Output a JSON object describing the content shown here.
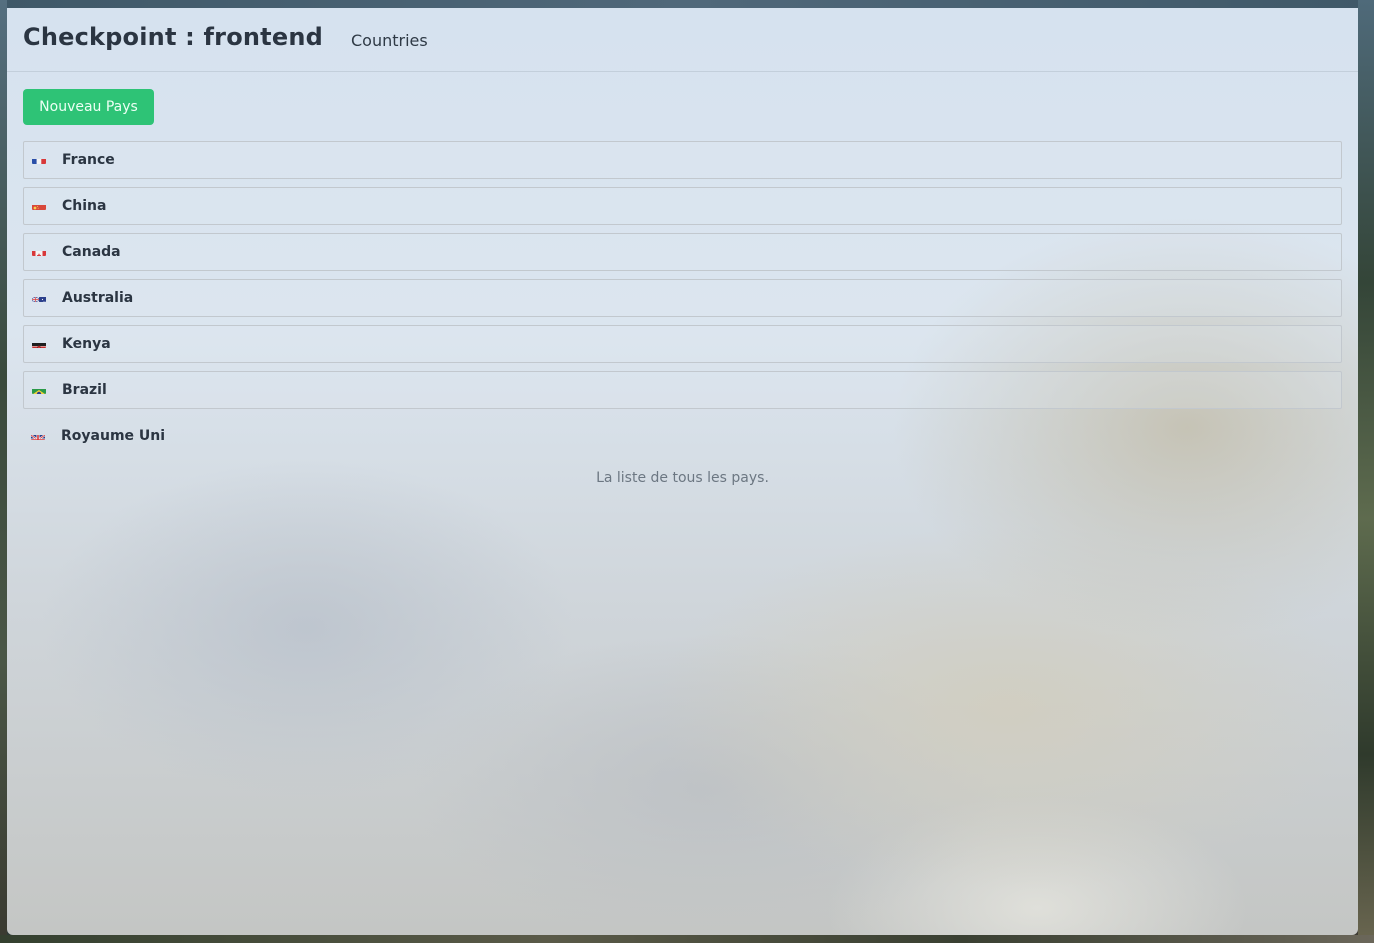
{
  "app": {
    "title": "Checkpoint : frontend",
    "nav_link": "Countries"
  },
  "toolbar": {
    "new_button_label": "Nouveau Pays"
  },
  "countries": [
    {
      "name": "France",
      "flag_icon": "flag-france-icon"
    },
    {
      "name": "China",
      "flag_icon": "flag-china-icon"
    },
    {
      "name": "Canada",
      "flag_icon": "flag-canada-icon"
    },
    {
      "name": "Australia",
      "flag_icon": "flag-australia-icon"
    },
    {
      "name": "Kenya",
      "flag_icon": "flag-kenya-icon"
    },
    {
      "name": "Brazil",
      "flag_icon": "flag-brazil-icon"
    },
    {
      "name": "Royaume Uni",
      "flag_icon": "flag-united-kingdom-icon"
    }
  ],
  "list_caption": "La liste de tous les pays.",
  "colors": {
    "accent_button": "#2ec376",
    "title_text": "#2b3542",
    "caption_text": "#6c7782"
  }
}
